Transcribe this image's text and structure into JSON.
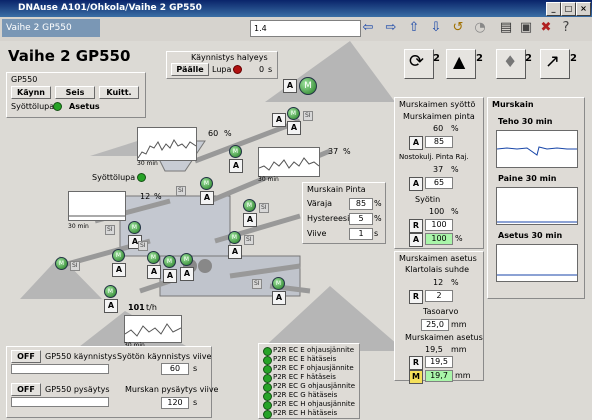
{
  "window": {
    "title": "DNAuse A101/Ohkola/Vaihe 2 GP550",
    "min": "_",
    "max": "□",
    "close": "×"
  },
  "toolbar": {
    "tab_title": "Vaihe 2 GP550",
    "field_value": "1.4"
  },
  "header": {
    "title": "Vaihe 2 GP550"
  },
  "startup_alarm": {
    "label": "Käynnistys halyeys",
    "state": "Päälle",
    "lupa": "Lupa",
    "value": "0",
    "unit": "s"
  },
  "control": {
    "group": "GP550",
    "start": "Käynn",
    "stop": "Seis",
    "ack": "Kuitt.",
    "permit_label": "Syöttölupa",
    "mode": "Asetus"
  },
  "icons": {
    "cycle_num": "2",
    "alarm_num": "2",
    "bell_num": "2",
    "trend_num": "2"
  },
  "process": {
    "trend1_value": "60",
    "trend1_unit": "%",
    "trend1_time": "30 min",
    "trend2_value": "37",
    "trend2_unit": "%",
    "trend2_time": "30 min",
    "syottolupa": "Syöttölupa",
    "feed_value": "12",
    "feed_unit": "%",
    "trend3_time": "30 min",
    "flow_value": "101",
    "flow_unit": "t/h",
    "trend4_time": "30 min",
    "si": "SI",
    "A": "A",
    "M": "M"
  },
  "crusher_level": {
    "title": "Murskain Pinta",
    "limit_label": "Väraja",
    "limit_value": "85",
    "limit_unit": "%",
    "hyst_label": "Hystereesi",
    "hyst_value": "5",
    "hyst_unit": "%",
    "delay_label": "Viive",
    "delay_value": "1",
    "delay_unit": "s"
  },
  "crusher_feed": {
    "title": "Murskaimen syöttö",
    "level_label": "Murskaimen pinta",
    "level_value": "60",
    "level_unit": "%",
    "a1": "A",
    "a1_value": "85",
    "ramp_label": "Nostokulj. Pinta Raj.",
    "ramp_value": "37",
    "ramp_unit": "%",
    "a2": "A",
    "a2_value": "65",
    "feeder_label": "Syötin",
    "feeder_value": "100",
    "feeder_unit": "%",
    "r": "R",
    "r_value": "100",
    "a3": "A",
    "a3_value": "100",
    "a3_unit": "%"
  },
  "crusher_set": {
    "title": "Murskaimen asetus",
    "ratio_label": "Klartolais suhde",
    "ratio_value": "12",
    "ratio_unit": "%",
    "r": "R",
    "r_value": "2",
    "target_label": "Tasoarvo",
    "target_value": "25,0",
    "target_unit": "mm",
    "setting_label": "Murskaimen asetus",
    "setting_value": "19,5",
    "setting_unit": "mm",
    "r2": "R",
    "r2_value": "19,5",
    "m": "M",
    "m_value": "19,7",
    "m_unit": "mm"
  },
  "murskain": {
    "title": "Murskain",
    "power_label": "Teho 30 min",
    "pressure_label": "Paine 30 min",
    "setting_label": "Asetus 30 min"
  },
  "bottom_left": {
    "off1": "OFF",
    "run1_label": "GP550 käynnistys",
    "delay1_label": "Syötön käynnistys viive",
    "delay1_value": "60",
    "delay1_unit": "s",
    "off2": "OFF",
    "run2_label": "GP550 pysäytys",
    "delay2_label": "Murskan pysäytys viive",
    "delay2_value": "120",
    "delay2_unit": "s"
  },
  "p2r_list": [
    "P2R EC E ohjausjännite",
    "P2R EC E hätäseis",
    "P2R EC F ohjausjännite",
    "P2R EC F hätäseis",
    "P2R EC G ohjausjännite",
    "P2R EC G hätäseis",
    "P2R EC H ohjausjännite",
    "P2R EC H hätäseis"
  ]
}
